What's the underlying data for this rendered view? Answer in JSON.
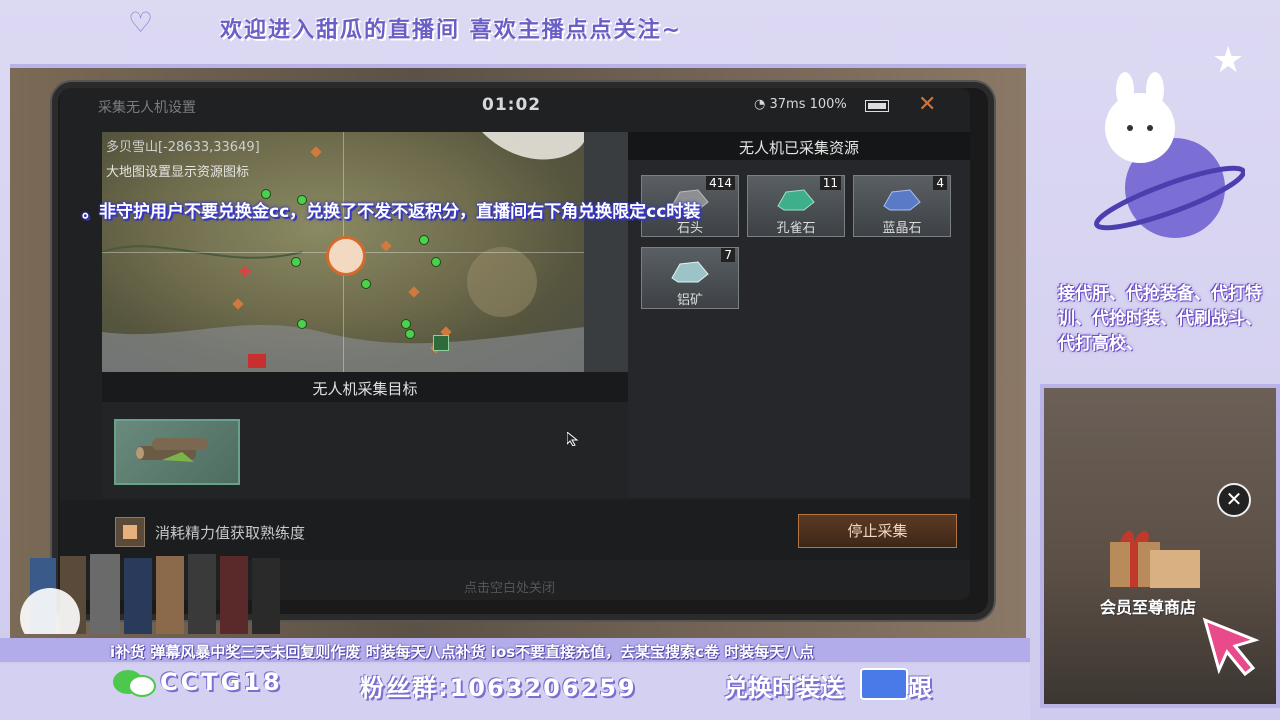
{
  "overlay": {
    "banner": "欢迎进入甜瓜的直播间 喜欢主播点点关注~",
    "notice": "。非守护用户不要兑换金cc，兑换了不发不返积分，直播间右下角兑换限定cc时装",
    "services": "接代肝、代抢装备、代打特训、代抢时装、代刷战斗、代打高校、",
    "ticker": "i补货      弹幕风暴中奖三天未回复则作废      时装每天八点补货      ios不要直接充值，去某宝搜索c卷      时装每天八点",
    "wechat_id": "CCTG18",
    "fan_group": "粉丝群:1063206259",
    "exchange_text": "兑换时装送",
    "exchange_tail": "跟",
    "video_caption": "会员至尊商店",
    "video_close": "✕"
  },
  "tablet": {
    "title": "采集无人机设置",
    "clock": "01:02",
    "ping": "37ms",
    "battery": "100%",
    "close": "✕",
    "map": {
      "coords": "多贝雪山[-28633,33649]",
      "hint": "大地图设置显示资源图标"
    },
    "target_header": "无人机采集目标",
    "resources_header": "无人机已采集资源",
    "resources": [
      {
        "name": "石头",
        "count": "414",
        "color": "#8e8f92"
      },
      {
        "name": "孔雀石",
        "count": "11",
        "color": "#3fae8a"
      },
      {
        "name": "蓝晶石",
        "count": "4",
        "color": "#5a7ac8"
      },
      {
        "name": "铝矿",
        "count": "7",
        "color": "#9cc4c8"
      }
    ],
    "checkbox_label": "消耗精力值获取熟练度",
    "stop_button": "停止采集",
    "close_hint": "点击空白处关闭"
  }
}
